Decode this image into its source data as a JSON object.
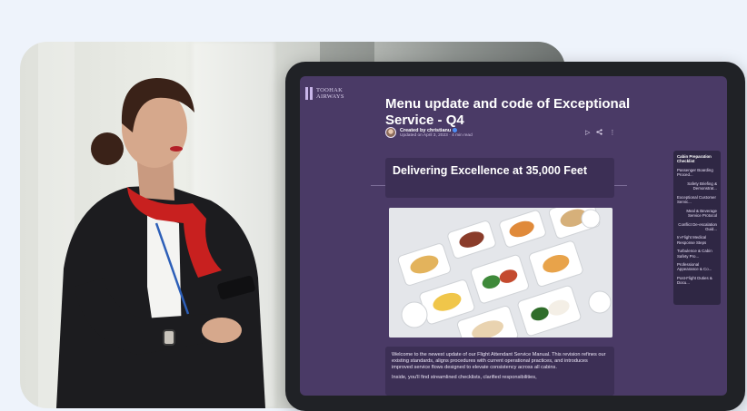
{
  "brand": {
    "name_line1": "TOOHAK",
    "name_line2": "AIRWAYS"
  },
  "document": {
    "title": "Menu update and code of Exceptional Service - Q4",
    "author_label": "Created by christianu",
    "meta": "Updated on April 3, 2023 · 4 min read",
    "actions": [
      "play-icon",
      "share-icon",
      "more-icon"
    ],
    "hero_title": "Delivering Excellence at 35,000 Feet",
    "paragraph1": "Welcome to the newest update of our Flight Attendant Service Manual. This revision refines our existing standards, aligns procedures with current operational practices, and introduces improved service flows designed to elevate consistency across all cabins.",
    "paragraph2": "Inside, you'll find streamlined checklists, clarified responsibilities,"
  },
  "toc": {
    "items": [
      {
        "label": "Cabin Preparation Checklist",
        "type": "title"
      },
      {
        "label": "Passenger Boarding Proced...",
        "type": "item"
      },
      {
        "label": "Safety Briefing & Demonstrat...",
        "type": "sub"
      },
      {
        "label": "Exceptional Customer Servic...",
        "type": "item"
      },
      {
        "label": "Meal & Beverage Service Protocol",
        "type": "sub"
      },
      {
        "label": "Conflict De-escalation Guid...",
        "type": "sub"
      },
      {
        "label": "In-Flight Medical Response Steps",
        "type": "item"
      },
      {
        "label": "Turbulence & Cabin Safety Pro...",
        "type": "item"
      },
      {
        "label": "Professional Appearance & Co...",
        "type": "item"
      },
      {
        "label": "Post-Flight Duties & Docu...",
        "type": "item"
      }
    ]
  },
  "colors": {
    "screen_bg": "#4a3a66",
    "panel_bg": "#3c2f55",
    "accent_red": "#c8201f"
  }
}
